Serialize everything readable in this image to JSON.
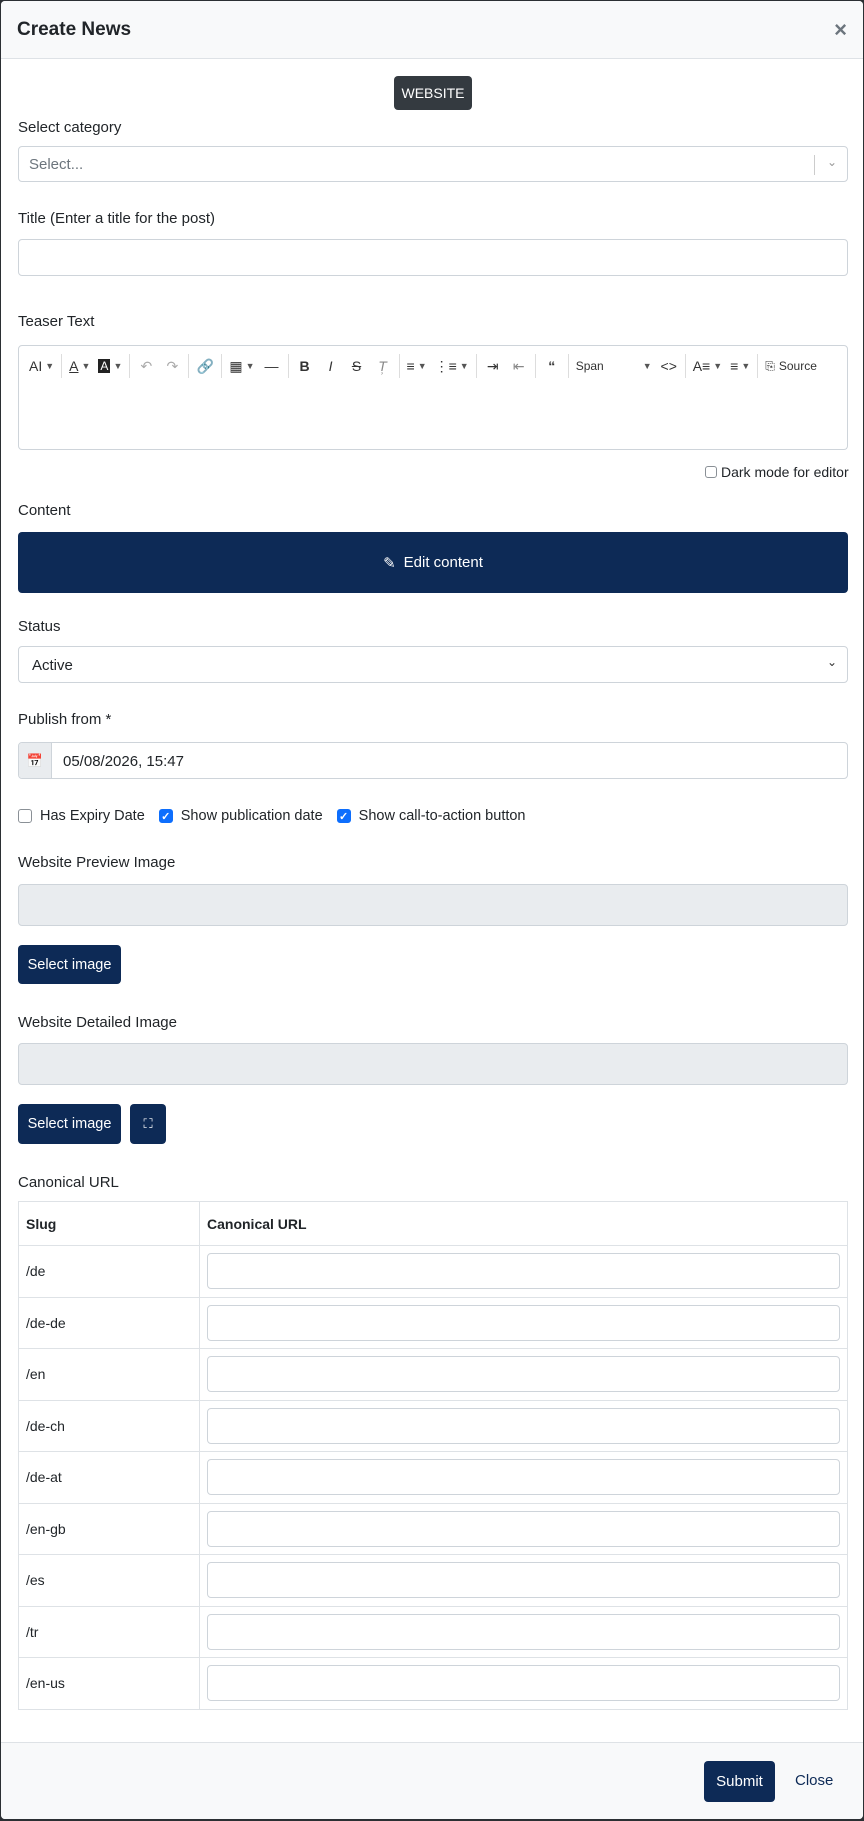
{
  "modal": {
    "title": "Create News",
    "close_glyph": "×"
  },
  "channel_badge": "WEBSITE",
  "category": {
    "label": "Select category",
    "placeholder": "Select..."
  },
  "title_field": {
    "label": "Title (Enter a title for the post)",
    "value": ""
  },
  "teaser": {
    "label": "Teaser Text",
    "span_option": "Span",
    "source_label": "Source",
    "dark_mode_label": "Dark mode for editor"
  },
  "content": {
    "label": "Content",
    "edit_button": "Edit content"
  },
  "status": {
    "label": "Status",
    "value": "Active"
  },
  "publish": {
    "label": "Publish from *",
    "value": "05/08/2026, 15:47"
  },
  "options": {
    "expiry": "Has Expiry Date",
    "pub_date": "Show publication date",
    "cta": "Show call-to-action button"
  },
  "preview_image": {
    "label": "Website Preview Image",
    "button": "Select image"
  },
  "detailed_image": {
    "label": "Website Detailed Image",
    "button": "Select image"
  },
  "canonical": {
    "label": "Canonical URL",
    "col_slug": "Slug",
    "col_url": "Canonical URL",
    "rows": [
      "/de",
      "/de-de",
      "/en",
      "/de-ch",
      "/de-at",
      "/en-gb",
      "/es",
      "/tr",
      "/en-us"
    ]
  },
  "footer": {
    "submit": "Submit",
    "close": "Close"
  },
  "colors": {
    "primary": "#0d2a56",
    "badge": "#343a40",
    "check": "#0d6efd"
  }
}
